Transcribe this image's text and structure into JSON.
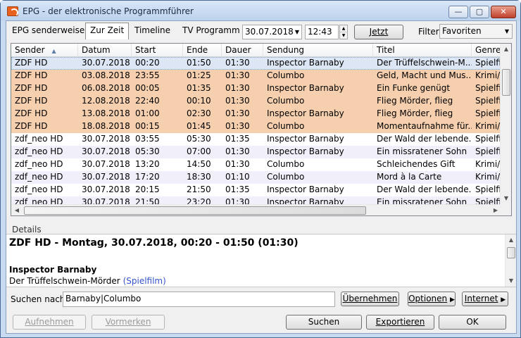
{
  "window": {
    "title": "EPG - der elektronische Programmführer"
  },
  "tabs": [
    "EPG senderweise",
    "Zur Zeit",
    "Timeline",
    "TV Programm"
  ],
  "toolbar": {
    "date": "30.07.2018",
    "time": "12:43",
    "now_label": "Jetzt",
    "filter_label": "Filter",
    "filter_value": "Favoriten"
  },
  "columns": [
    "Sender",
    "Datum",
    "Start",
    "Ende",
    "Dauer",
    "Sendung",
    "Titel",
    "Genre"
  ],
  "rows": [
    {
      "sender": "ZDF HD",
      "datum": "30.07.2018",
      "start": "00:20",
      "ende": "01:50",
      "dauer": "01:30",
      "sendung": "Inspector Barnaby",
      "titel": "Der Trüffelschwein-M...",
      "genre": "Spielfilm",
      "style": "selected"
    },
    {
      "sender": "ZDF HD",
      "datum": "03.08.2018",
      "start": "23:55",
      "ende": "01:25",
      "dauer": "01:30",
      "sendung": "Columbo",
      "titel": "Geld, Macht und Mus...",
      "genre": "Krimi/Thriller",
      "style": "hl"
    },
    {
      "sender": "ZDF HD",
      "datum": "06.08.2018",
      "start": "00:05",
      "ende": "01:35",
      "dauer": "01:30",
      "sendung": "Inspector Barnaby",
      "titel": "Ein Funke genügt",
      "genre": "Spielfilm",
      "style": "hl"
    },
    {
      "sender": "ZDF HD",
      "datum": "12.08.2018",
      "start": "22:40",
      "ende": "00:10",
      "dauer": "01:30",
      "sendung": "Columbo",
      "titel": "Flieg Mörder, flieg",
      "genre": "Spielfilm",
      "style": "hl"
    },
    {
      "sender": "ZDF HD",
      "datum": "13.08.2018",
      "start": "01:00",
      "ende": "02:30",
      "dauer": "01:30",
      "sendung": "Inspector Barnaby",
      "titel": "Flieg Mörder, flieg",
      "genre": "Spielfilm",
      "style": "hl"
    },
    {
      "sender": "ZDF HD",
      "datum": "18.08.2018",
      "start": "00:15",
      "ende": "01:45",
      "dauer": "01:30",
      "sendung": "Columbo",
      "titel": "Momentaufnahme für...",
      "genre": "Krimi/Thriller",
      "style": "hl"
    },
    {
      "sender": "zdf_neo HD",
      "datum": "30.07.2018",
      "start": "03:55",
      "ende": "05:30",
      "dauer": "01:35",
      "sendung": "Inspector Barnaby",
      "titel": "Der Wald der lebende...",
      "genre": "Spielfilm",
      "style": "white"
    },
    {
      "sender": "zdf_neo HD",
      "datum": "30.07.2018",
      "start": "05:30",
      "ende": "07:00",
      "dauer": "01:30",
      "sendung": "Inspector Barnaby",
      "titel": "Ein missratener Sohn",
      "genre": "Spielfilm",
      "style": "alt"
    },
    {
      "sender": "zdf_neo HD",
      "datum": "30.07.2018",
      "start": "13:20",
      "ende": "14:50",
      "dauer": "01:30",
      "sendung": "Columbo",
      "titel": "Schleichendes Gift",
      "genre": "Krimi/Thriller",
      "style": "white"
    },
    {
      "sender": "zdf_neo HD",
      "datum": "30.07.2018",
      "start": "17:20",
      "ende": "18:30",
      "dauer": "01:10",
      "sendung": "Columbo",
      "titel": "Mord à la Carte",
      "genre": "Krimi/Thriller",
      "style": "alt"
    },
    {
      "sender": "zdf_neo HD",
      "datum": "30.07.2018",
      "start": "20:15",
      "ende": "21:50",
      "dauer": "01:35",
      "sendung": "Inspector Barnaby",
      "titel": "Der Wald der lebende...",
      "genre": "Spielfilm",
      "style": "white"
    },
    {
      "sender": "zdf_neo HD",
      "datum": "30.07.2018",
      "start": "21:50",
      "ende": "23:20",
      "dauer": "01:30",
      "sendung": "Inspector Barnaby",
      "titel": "Ein missratener Sohn",
      "genre": "Spielfilm",
      "style": "alt"
    }
  ],
  "details": {
    "label": "Details",
    "header": "ZDF HD - Montag, 30.07.2018, 00:20 - 01:50  (01:30)",
    "title": "Inspector Barnaby",
    "subtitle": "Der Trüffelschwein-Mörder",
    "genre": "(Spielfilm)"
  },
  "search": {
    "label": "Suchen nach:",
    "value": "Barnaby|Columbo",
    "apply": "Übernehmen",
    "options": "Optionen",
    "internet": "Internet"
  },
  "footer": {
    "record": "Aufnehmen",
    "schedule": "Vormerken",
    "search": "Suchen",
    "export": "Exportieren",
    "ok": "OK"
  },
  "colors": {
    "selected": "#dce6f4",
    "highlight": "#f5cfae",
    "alt": "#f1f0fa",
    "white": "#ffffff",
    "genre_link": "#3355cc"
  }
}
